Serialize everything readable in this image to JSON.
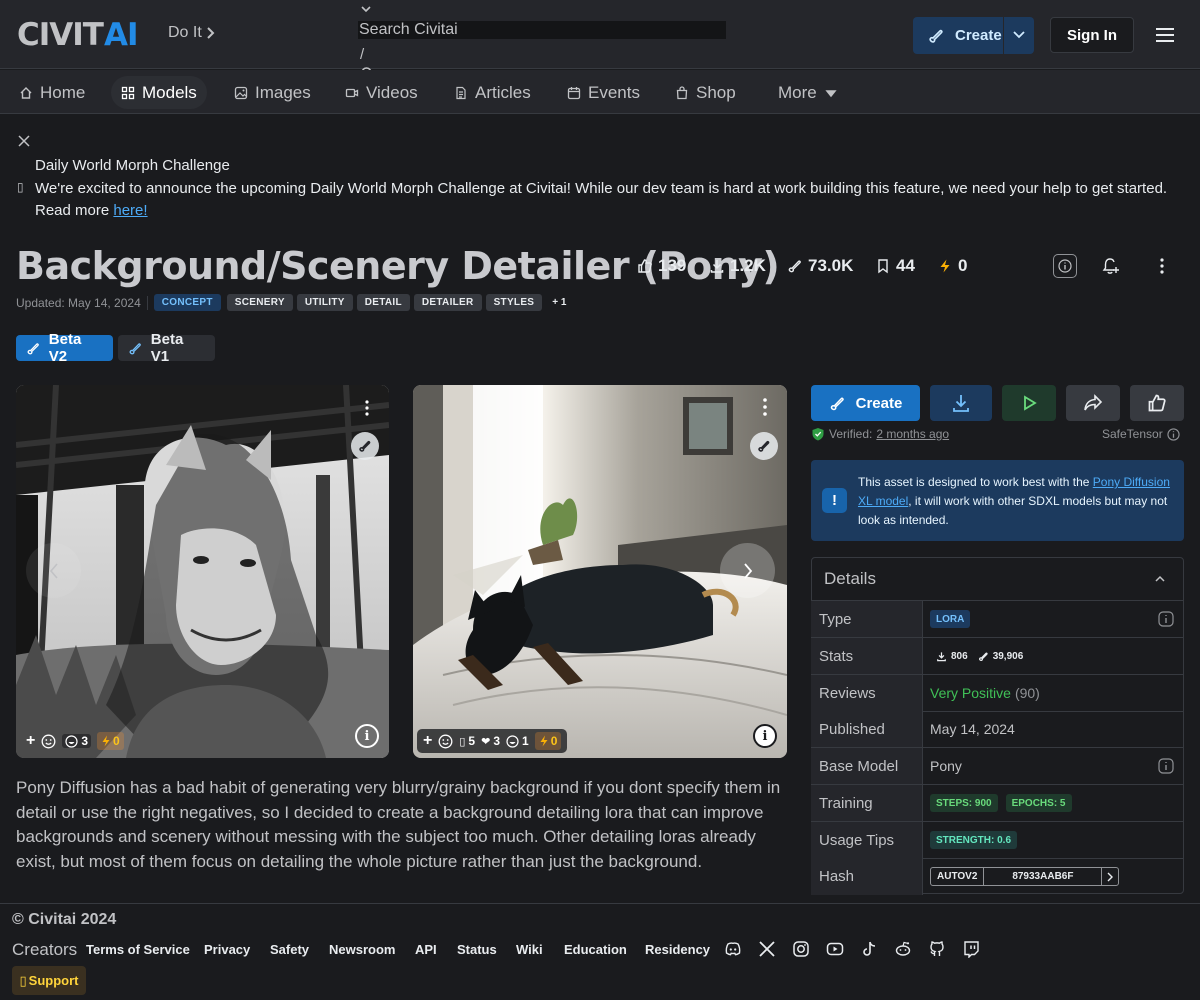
{
  "header": {
    "logo_main": "CIVIT",
    "logo_accent": "AI",
    "tagline": "Do It",
    "search_placeholder": "Search Civitai",
    "search_slash": "/",
    "create_label": "Create",
    "signin_label": "Sign In"
  },
  "nav": {
    "items": [
      {
        "label": "Home",
        "icon": "home-icon"
      },
      {
        "label": "Models",
        "icon": "grid-icon"
      },
      {
        "label": "Images",
        "icon": "photo-icon"
      },
      {
        "label": "Videos",
        "icon": "video-icon"
      },
      {
        "label": "Articles",
        "icon": "file-text-icon"
      },
      {
        "label": "Events",
        "icon": "calendar-icon"
      },
      {
        "label": "Shop",
        "icon": "bag-icon"
      },
      {
        "label": "More",
        "icon": "caret-down-icon"
      }
    ],
    "active": "Models"
  },
  "announcement": {
    "title": "Daily World Morph Challenge",
    "body": "We're excited to announce the upcoming Daily World Morph Challenge at Civitai! While our dev team is hard at work building this feature, we need your help to get started. Read more ",
    "link": "here!"
  },
  "model": {
    "title": "Background/Scenery Detailer (Pony)",
    "stats": {
      "likes": "139",
      "downloads": "1.2K",
      "generations": "73.0K",
      "collected": "44",
      "buzz": "0"
    },
    "updated": "Updated: May 14, 2024",
    "tags": [
      "CONCEPT",
      "SCENERY",
      "UTILITY",
      "DETAIL",
      "DETAILER",
      "STYLES"
    ],
    "more_tags": "+ 1",
    "versions": [
      "Beta V2",
      "Beta V1"
    ],
    "active_version": "Beta V2"
  },
  "gallery": {
    "images": [
      {
        "reactions": {
          "comments": "3",
          "buzz": "0"
        }
      },
      {
        "reactions": {
          "likes_count": "5",
          "hearts": "3",
          "comments": "1",
          "buzz": "0"
        }
      }
    ]
  },
  "description": "Pony Diffusion has a bad habit of generating very blurry/grainy background if you dont specify them in detail or use the right negatives, so I decided to create a background detailing lora that can improve backgrounds and scenery without messing with the subject too much. Other detailing loras already exist, but most of them focus on detailing the whole picture rather than just the background.",
  "sidebar": {
    "create_label": "Create",
    "verified_label": "Verified:",
    "verified_when": "2 months ago",
    "safetensor": "SafeTensor",
    "alert_pre": "This asset is designed to work best with the ",
    "alert_link": "Pony Diffusion XL model",
    "alert_post": ", it will work with other SDXL models but may not look as intended.",
    "details_title": "Details",
    "details": {
      "type_label": "Type",
      "type_value": "LORA",
      "stats_label": "Stats",
      "stats_downloads": "806",
      "stats_generations": "39,906",
      "reviews_label": "Reviews",
      "reviews_value": "Very Positive",
      "reviews_count": "(90)",
      "published_label": "Published",
      "published_value": "May 14, 2024",
      "base_label": "Base Model",
      "base_value": "Pony",
      "training_label": "Training",
      "training_steps": "STEPS: 900",
      "training_epochs": "EPOCHS: 5",
      "tips_label": "Usage Tips",
      "tips_strength": "STRENGTH: 0.6",
      "hash_label": "Hash",
      "hash_type": "AUTOV2",
      "hash_value": "87933AAB6F"
    }
  },
  "footer": {
    "copyright": "© Civitai 2024",
    "creators": "Creators",
    "links": [
      "Terms of Service",
      "Privacy",
      "Safety",
      "Newsroom",
      "API",
      "Status",
      "Wiki",
      "Education",
      "Residency"
    ],
    "social": [
      "discord-icon",
      "x-icon",
      "instagram-icon",
      "youtube-icon",
      "tiktok-icon",
      "reddit-icon",
      "github-icon",
      "twitch-icon"
    ],
    "support": "Support"
  },
  "colors": {
    "accent": "#228be6",
    "background": "#1a1b1e",
    "surface": "#25262b",
    "positive": "#40c057",
    "buzz": "#fcc419"
  }
}
